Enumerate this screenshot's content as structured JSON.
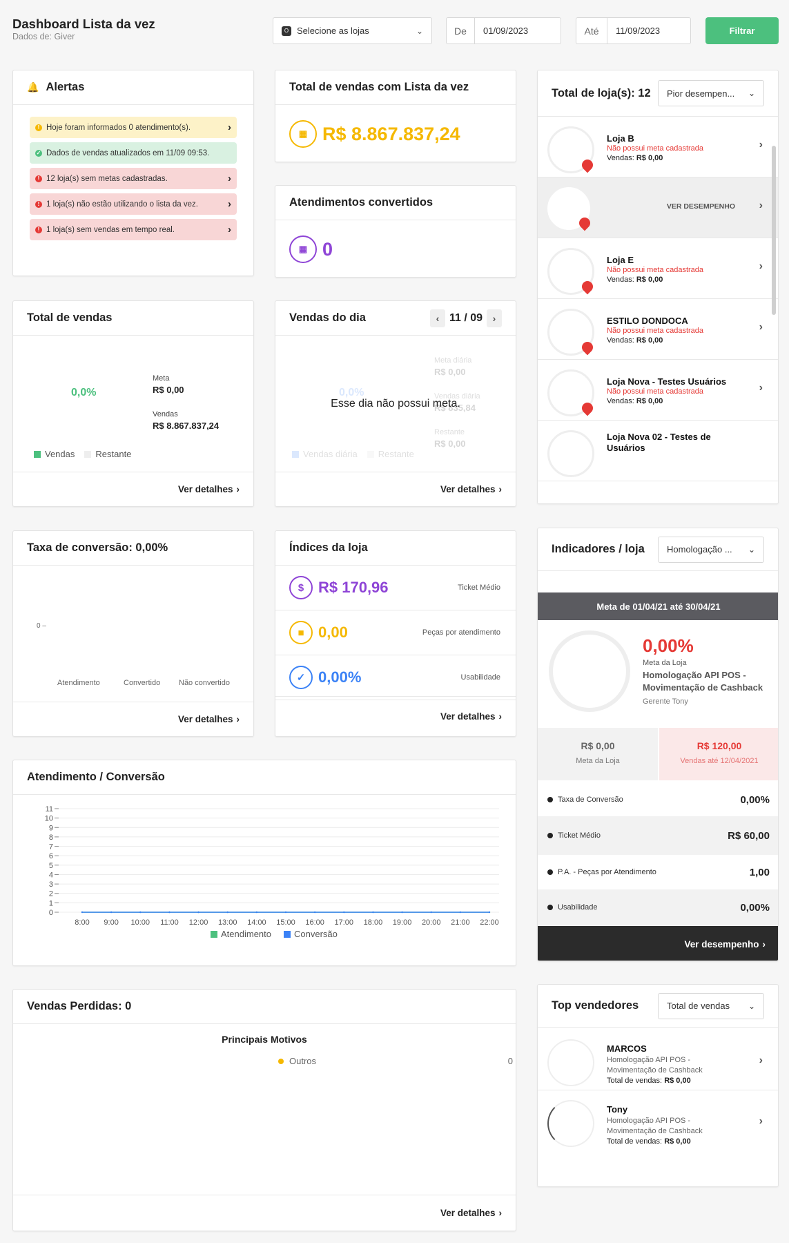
{
  "header": {
    "title": "Dashboard Lista da vez",
    "subtitle": "Dados de: Giver",
    "store_select": "Selecione as lojas",
    "from_label": "De",
    "from_value": "01/09/2023",
    "to_label": "Até",
    "to_value": "11/09/2023",
    "filter_button": "Filtrar"
  },
  "alerts": {
    "title": "Alertas",
    "items": [
      {
        "text": "Hoje foram informados 0 atendimento(s).",
        "kind": "yellow",
        "arrow": true
      },
      {
        "text": "Dados de vendas atualizados em 11/09 09:53.",
        "kind": "green",
        "arrow": false
      },
      {
        "text": "12 loja(s) sem metas cadastradas.",
        "kind": "red",
        "arrow": true
      },
      {
        "text": "1 loja(s) não estão utilizando o lista da vez.",
        "kind": "red",
        "arrow": true
      },
      {
        "text": "1 loja(s) sem vendas em tempo real.",
        "kind": "red",
        "arrow": true
      }
    ]
  },
  "total_sales_list": {
    "title": "Total de vendas com Lista da vez",
    "value": "R$ 8.867.837,24"
  },
  "converted": {
    "title": "Atendimentos convertidos",
    "value": "0"
  },
  "stores_panel": {
    "title": "Total de loja(s): 12",
    "sort_select": "Pior desempen...",
    "hover_action": "VER DESEMPENHO",
    "no_goal_text": "Não possui meta cadastrada",
    "sales_prefix": "Vendas:",
    "stores": [
      {
        "name": "Loja B",
        "sales": "R$ 0,00"
      },
      {
        "name": "",
        "sales": ""
      },
      {
        "name": "Loja E",
        "sales": "R$ 0,00"
      },
      {
        "name": "ESTILO DONDOCA",
        "sales": "R$ 0,00"
      },
      {
        "name": "Loja Nova - Testes Usuários",
        "sales": "R$ 0,00"
      },
      {
        "name": "Loja Nova 02 - Testes de Usuários",
        "sales": ""
      }
    ]
  },
  "total_sales": {
    "title": "Total de vendas",
    "percent": "0,0%",
    "goal_label": "Meta",
    "goal_value": "R$ 0,00",
    "sales_label": "Vendas",
    "sales_value": "R$ 8.867.837,24",
    "legend_sales": "Vendas",
    "legend_rest": "Restante",
    "details": "Ver detalhes",
    "colors": {
      "sales": "#4cc07e",
      "rest": "#eeeeee"
    }
  },
  "daily_sales": {
    "title": "Vendas do dia",
    "date": "11 / 09",
    "message": "Esse dia não possui meta.",
    "ghost": {
      "percent": "0,0%",
      "goal_label": "Meta diária",
      "goal_value": "R$ 0,00",
      "sales_label": "Vendas diária",
      "sales_value": "R$ 835,84",
      "rest_label": "Restante",
      "rest_value": "R$ 0,00",
      "legend_sales": "Vendas diária",
      "legend_rest": "Restante"
    },
    "details": "Ver detalhes"
  },
  "conversion_rate": {
    "title": "Taxa de conversão: 0,00%",
    "y_tick": "0",
    "categories": [
      "Atendimento",
      "Convertido",
      "Não convertido"
    ],
    "details": "Ver detalhes"
  },
  "store_index": {
    "title": "Índices da loja",
    "rows": [
      {
        "value": "R$ 170,96",
        "label": "Ticket Médio",
        "color": "#8e44d6",
        "icon": "hand-money-icon"
      },
      {
        "value": "0,00",
        "label": "Peças por atendimento",
        "color": "#f5b800",
        "icon": "shopping-bag-icon"
      },
      {
        "value": "0,00%",
        "label": "Usabilidade",
        "color": "#3b82f6",
        "icon": "check-icon"
      }
    ],
    "details": "Ver detalhes"
  },
  "indicators": {
    "title": "Indicadores / loja",
    "store_select": "Homologação ...",
    "period": "Meta de 01/04/21 até 30/04/21",
    "percent": "0,00%",
    "goal_caption": "Meta da Loja",
    "store_name": "Homologação API POS - Movimentação de Cashback",
    "manager": "Gerente Tony",
    "goal_value": "R$ 0,00",
    "goal_label": "Meta da Loja",
    "sales_value": "R$ 120,00",
    "sales_label": "Vendas até 12/04/2021",
    "kpis": [
      {
        "label": "Taxa de Conversão",
        "value": "0,00%"
      },
      {
        "label": "Ticket Médio",
        "value": "R$ 60,00"
      },
      {
        "label": "P.A. - Peças por Atendimento",
        "value": "1,00"
      },
      {
        "label": "Usabilidade",
        "value": "0,00%"
      }
    ],
    "action": "Ver desempenho",
    "percent_color": "#e53935"
  },
  "attendance_chart": {
    "title": "Atendimento / Conversão",
    "details": ""
  },
  "chart_data": {
    "type": "line",
    "title": "Atendimento / Conversão",
    "x": [
      "8:00",
      "9:00",
      "10:00",
      "11:00",
      "12:00",
      "13:00",
      "14:00",
      "15:00",
      "16:00",
      "17:00",
      "18:00",
      "19:00",
      "20:00",
      "21:00",
      "22:00"
    ],
    "ylim": [
      0,
      11
    ],
    "yticks": [
      0,
      1,
      2,
      3,
      4,
      5,
      6,
      7,
      8,
      9,
      10,
      11
    ],
    "series": [
      {
        "name": "Atendimento",
        "color": "#4cc07e",
        "values": [
          0,
          0,
          0,
          0,
          0,
          0,
          0,
          0,
          0,
          0,
          0,
          0,
          0,
          0,
          0
        ]
      },
      {
        "name": "Conversão",
        "color": "#3b82f6",
        "values": [
          0,
          0,
          0,
          0,
          0,
          0,
          0,
          0,
          0,
          0,
          0,
          0,
          0,
          0,
          0
        ]
      }
    ],
    "grid": true,
    "legend": "bottom"
  },
  "lost_sales": {
    "title": "Vendas Perdidas: 0",
    "subtitle": "Principais Motivos",
    "reasons": [
      {
        "label": "Outros",
        "value": "0",
        "color": "#f5b800"
      }
    ],
    "details": "Ver detalhes"
  },
  "top_sellers": {
    "title": "Top vendedores",
    "select": "Total de vendas",
    "total_prefix": "Total de vendas:",
    "sellers": [
      {
        "name": "MARCOS",
        "store": "Homologação API POS - Movimentação de Cashback",
        "total": "R$ 0,00"
      },
      {
        "name": "Tony",
        "store": "Homologação API POS - Movimentação de Cashback",
        "total": "R$ 0,00"
      }
    ]
  }
}
